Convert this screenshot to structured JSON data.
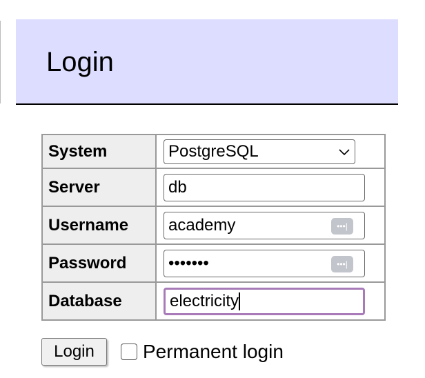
{
  "header": {
    "title": "Login"
  },
  "form": {
    "rows": [
      {
        "label": "System",
        "value": "PostgreSQL",
        "type": "select"
      },
      {
        "label": "Server",
        "value": "db"
      },
      {
        "label": "Username",
        "value": "academy"
      },
      {
        "label": "Password",
        "value": "•••••••"
      },
      {
        "label": "Database",
        "value": "electricity"
      }
    ]
  },
  "actions": {
    "login_label": "Login",
    "permanent_login_label": "Permanent login",
    "permanent_login_checked": false
  }
}
